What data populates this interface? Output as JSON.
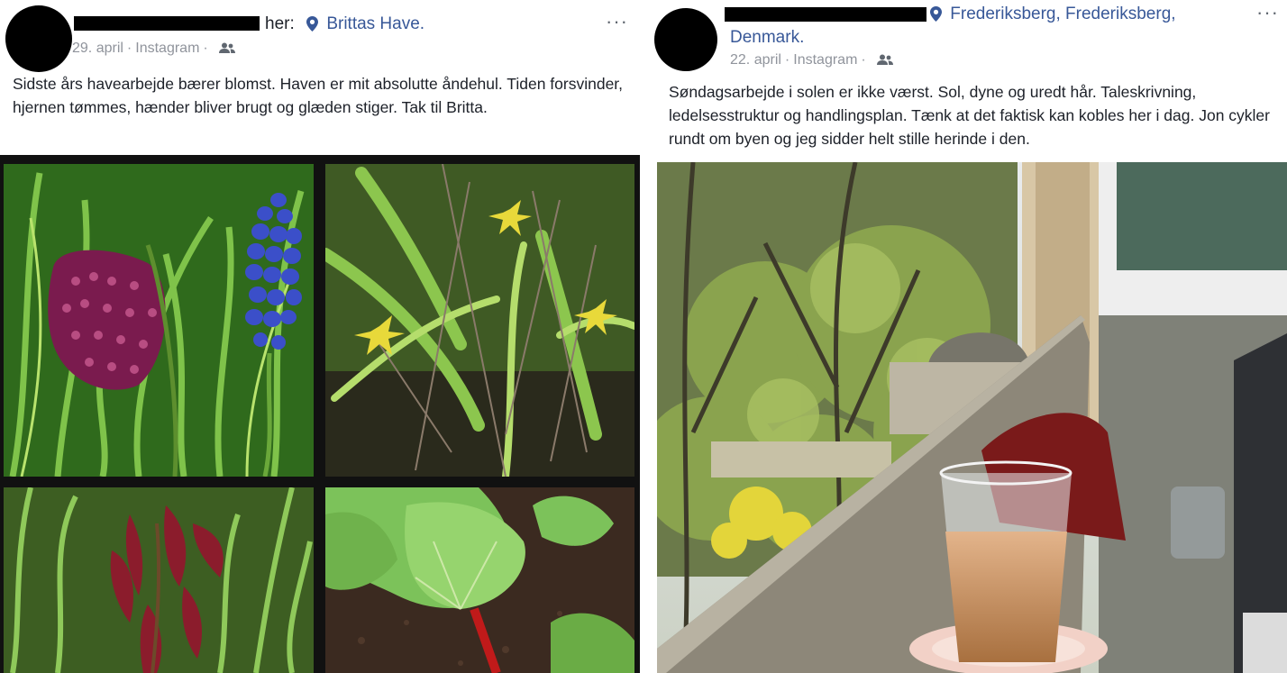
{
  "posts": [
    {
      "author_suffix": "her:",
      "location": "Brittas Have.",
      "date": "29. april",
      "source": "Instagram",
      "audience_icon": "people-icon",
      "more_label": "···",
      "text": "Sidste års havearbejde bærer blomst. Haven er mit absolutte åndehul. Tiden forsvinder, hjernen tømmes, hænder bliver brugt og glæden stiger. Tak til Britta.",
      "photos": [
        "fritillary-muscari-photo",
        "yellow-star-flower-photo",
        "red-shoots-photo",
        "rhubarb-leaves-photo"
      ]
    },
    {
      "location_line1": "Frederiksberg, Frederiksberg,",
      "location_line2": "Denmark.",
      "date": "22. april",
      "source": "Instagram",
      "audience_icon": "people-icon",
      "more_label": "···",
      "text": "Søndagsarbejde i solen er ikke værst. Sol, dyne og uredt hår. Taleskrivning, ledelsesstruktur og handlingsplan. Tænk at det faktisk kan kobles her i dag. Jon cykler rundt om byen og jeg sidder helt stille herinde i den.",
      "photo": "balcony-coffee-photo"
    }
  ],
  "colors": {
    "link": "#385898",
    "text": "#1d2129",
    "meta": "#90949c"
  }
}
